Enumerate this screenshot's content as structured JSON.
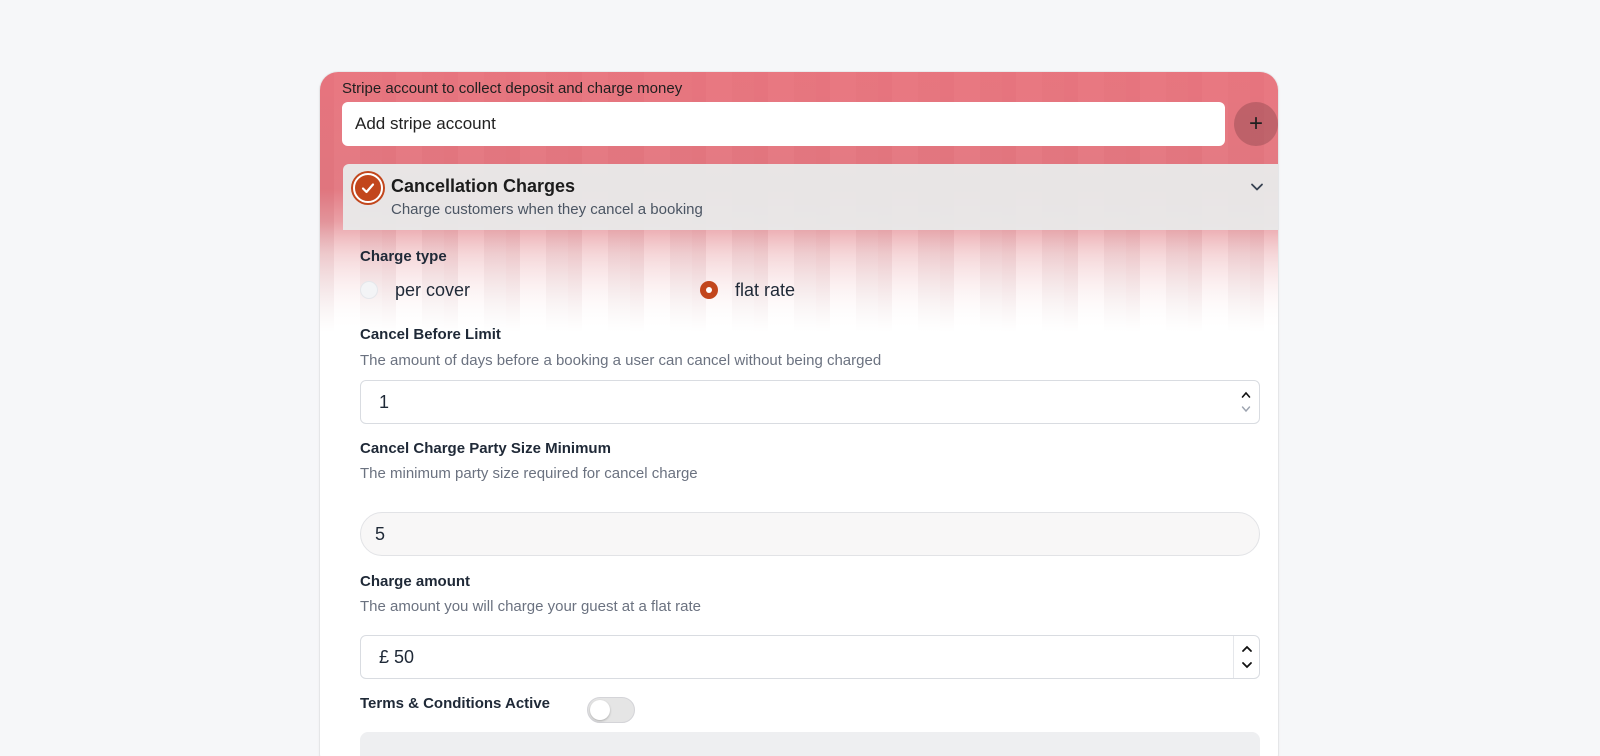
{
  "stripe": {
    "label": "Stripe account to collect deposit and charge money",
    "selected": "Add stripe account",
    "add_symbol": "+"
  },
  "section": {
    "title": "Cancellation Charges",
    "subtitle": "Charge customers when they cancel a booking",
    "checked": true
  },
  "charge_type": {
    "label": "Charge type",
    "options": [
      "per cover",
      "flat rate"
    ],
    "selected": "flat rate"
  },
  "cancel_before": {
    "label": "Cancel Before Limit",
    "help": "The amount of days before a booking a user can cancel without being charged",
    "value": "1"
  },
  "party_min": {
    "label": "Cancel Charge Party Size Minimum",
    "help": "The minimum party size required for cancel charge",
    "value": "5"
  },
  "charge_amount": {
    "label": "Charge amount",
    "help": "The amount you will charge your guest at a flat rate",
    "value": "£ 50"
  },
  "terms": {
    "label": "Terms & Conditions Active",
    "active": false
  },
  "colors": {
    "accent": "#c2461c",
    "hero": "#e06a74",
    "page_bg": "#f6f7f9"
  }
}
